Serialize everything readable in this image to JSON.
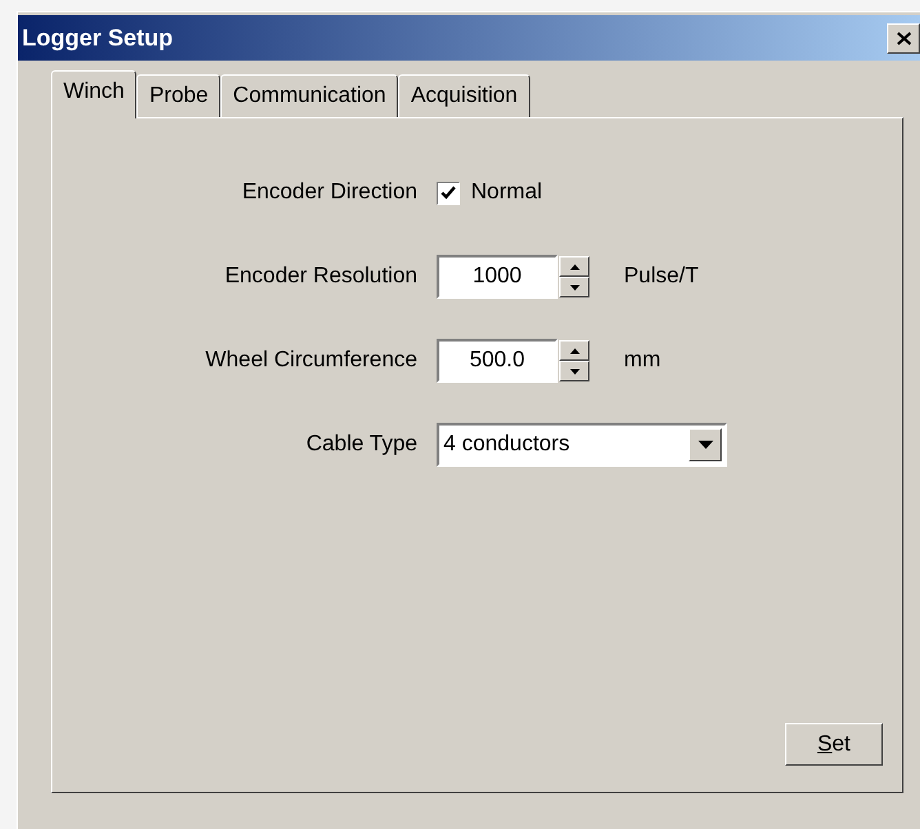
{
  "window": {
    "title": "Logger Setup"
  },
  "tabs": [
    {
      "label": "Winch",
      "selected": true
    },
    {
      "label": "Probe",
      "selected": false
    },
    {
      "label": "Communication",
      "selected": false
    },
    {
      "label": "Acquisition",
      "selected": false
    }
  ],
  "fields": [
    {
      "kind": "checkbox",
      "label": "Encoder Direction",
      "option": "Normal",
      "checked": true
    },
    {
      "kind": "spin",
      "label": "Encoder Resolution",
      "value": "1000",
      "unit": "Pulse/T"
    },
    {
      "kind": "spin",
      "label": "Wheel Circumference",
      "value": "500.0",
      "unit": "mm"
    },
    {
      "kind": "combo",
      "label": "Cable Type",
      "value": "4 conductors"
    }
  ],
  "buttons": [
    {
      "label": "Set",
      "mnemonic_underlined": true
    }
  ]
}
